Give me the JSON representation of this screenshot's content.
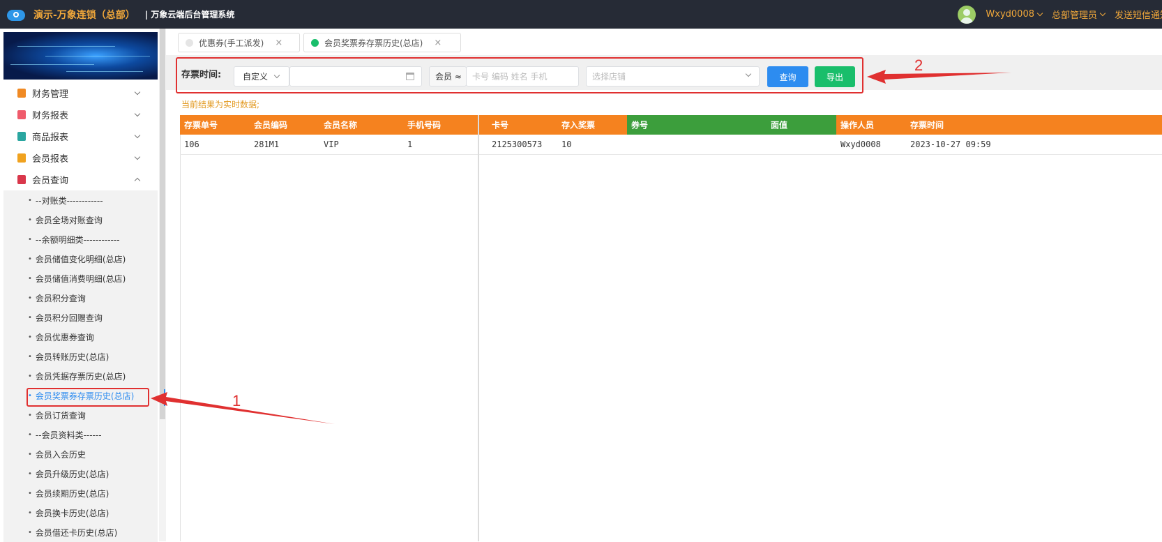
{
  "header": {
    "brand": "演示-万象连锁（总部）",
    "system": "| 万象云端后台管理系统",
    "user": "Wxyd0008",
    "role": "总部管理员",
    "sms": "发送短信通知"
  },
  "sidebar": {
    "menu": [
      {
        "label": "财务管理",
        "color": "#f08a24"
      },
      {
        "label": "财务报表",
        "color": "#ef5b6b"
      },
      {
        "label": "商品报表",
        "color": "#2aa6a0"
      },
      {
        "label": "会员报表",
        "color": "#f0a21f"
      },
      {
        "label": "会员查询",
        "color": "#d9374b"
      }
    ],
    "submenu": [
      "--对账类------------",
      "会员全场对账查询",
      "--余额明细类------------",
      "会员储值变化明细(总店)",
      "会员储值消费明细(总店)",
      "会员积分查询",
      "会员积分回赠查询",
      "会员优惠券查询",
      "会员转账历史(总店)",
      "会员凭据存票历史(总店)",
      "会员奖票券存票历史(总店)",
      "会员订货查询",
      "--会员资料类------",
      "会员入会历史",
      "会员升级历史(总店)",
      "会员续期历史(总店)",
      "会员换卡历史(总店)",
      "会员借还卡历史(总店)"
    ]
  },
  "tabs": [
    {
      "label": "优惠券(手工派发)",
      "close": "×"
    },
    {
      "label": "会员奖票券存票历史(总店)",
      "close": "×"
    }
  ],
  "filter": {
    "label": "存票时间:",
    "range_select": "自定义",
    "member_prefix": "会员 ≈",
    "member_placeholder": "卡号 编码 姓名 手机",
    "store_placeholder": "选择店铺",
    "query_btn": "查询",
    "export_btn": "导出"
  },
  "notice": "当前结果为实时数据;",
  "table": {
    "headers": [
      "存票单号",
      "会员编码",
      "会员名称",
      "手机号码",
      "卡号",
      "存入奖票",
      "券号",
      "面值",
      "操作人员",
      "存票时间"
    ],
    "rows": [
      [
        "106",
        "281M1",
        "VIP",
        "1",
        "2125300573",
        "10",
        "",
        "",
        "Wxyd0008",
        "2023-10-27 09:59"
      ]
    ]
  },
  "annotations": {
    "label1": "1",
    "label2": "2"
  },
  "colors": {
    "orange": "#f5821f",
    "green": "#3c9e3c",
    "blue": "#2d8cf0",
    "export": "#19be6b",
    "red": "#e03030"
  }
}
